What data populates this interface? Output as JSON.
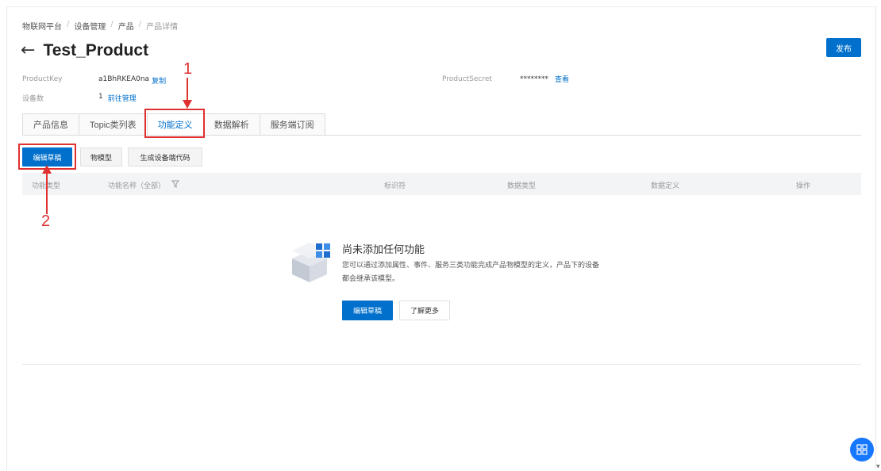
{
  "breadcrumb": [
    "物联网平台",
    "设备管理",
    "产品",
    "产品详情"
  ],
  "breadcrumb_sep": "/",
  "title": "Test_Product",
  "publish_label": "发布",
  "meta": {
    "product_key_label": "ProductKey",
    "product_key_value": "a1BhRKEA0na",
    "copy_label": "复制",
    "device_count_label": "设备数",
    "device_count_value": "1",
    "manage_label": "前往管理",
    "product_secret_label": "ProductSecret",
    "product_secret_value": "********",
    "view_label": "查看"
  },
  "tabs": [
    "产品信息",
    "Topic类列表",
    "功能定义",
    "数据解析",
    "服务端订阅"
  ],
  "active_tab": "功能定义",
  "toolbar": {
    "edit_draft": "编辑草稿",
    "thing_model": "物模型",
    "gen_code": "生成设备端代码"
  },
  "table_headers": {
    "type": "功能类型",
    "name": "功能名称（全部）",
    "identifier": "标识符",
    "data_type": "数据类型",
    "data_def": "数据定义",
    "action": "操作"
  },
  "empty": {
    "title": "尚未添加任何功能",
    "desc": "您可以通过添加属性、事件、服务三类功能完成产品物模型的定义，产品下的设备都会继承该模型。",
    "edit_btn": "编辑草稿",
    "more_btn": "了解更多"
  },
  "annotations": {
    "one": "1",
    "two": "2"
  },
  "colors": {
    "primary": "#0070cc",
    "annotation": "#e03131",
    "fab": "#1677ff"
  }
}
